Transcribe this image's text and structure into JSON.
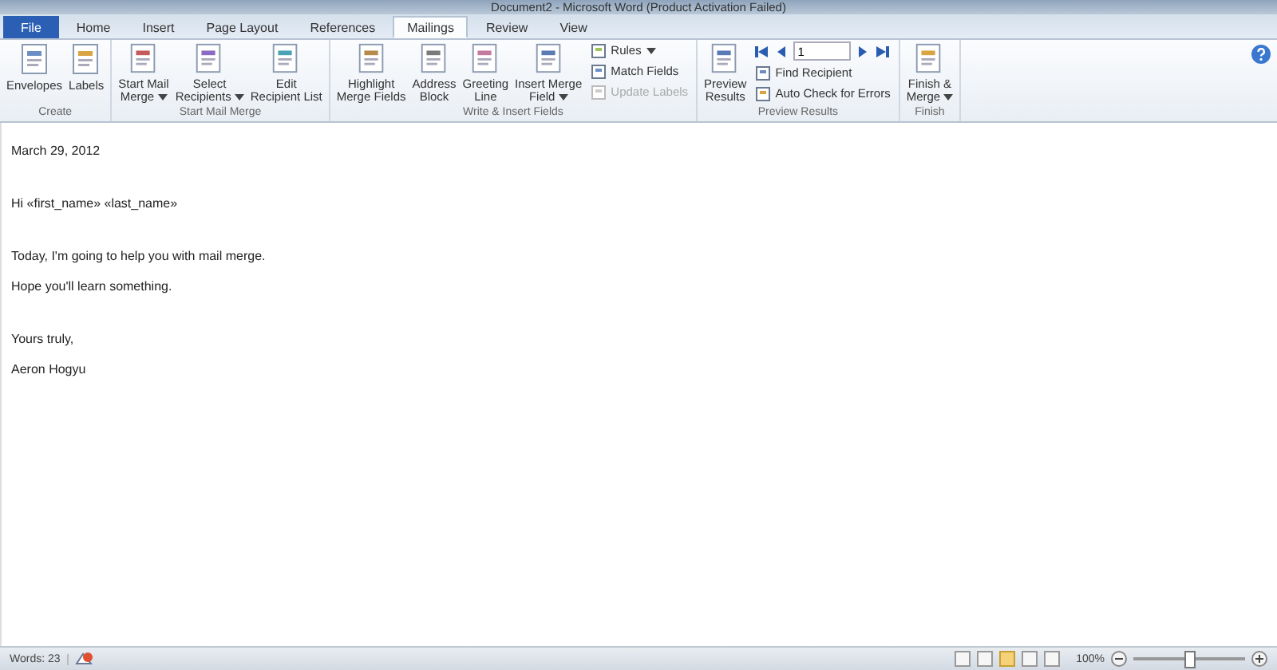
{
  "window": {
    "title": "Document2 - Microsoft Word (Product Activation Failed)"
  },
  "tabs": [
    {
      "label": "File",
      "selected": false,
      "kind": "file"
    },
    {
      "label": "Home",
      "selected": false,
      "kind": "tab"
    },
    {
      "label": "Insert",
      "selected": false,
      "kind": "tab"
    },
    {
      "label": "Page Layout",
      "selected": false,
      "kind": "tab"
    },
    {
      "label": "References",
      "selected": false,
      "kind": "tab"
    },
    {
      "label": "Mailings",
      "selected": true,
      "kind": "tab"
    },
    {
      "label": "Review",
      "selected": false,
      "kind": "tab"
    },
    {
      "label": "View",
      "selected": false,
      "kind": "tab"
    }
  ],
  "ribbon": {
    "groups": [
      {
        "label": "Create",
        "items": [
          {
            "kind": "large",
            "lines": [
              "Envelopes"
            ],
            "dropdown": false
          },
          {
            "kind": "large",
            "lines": [
              "Labels"
            ],
            "dropdown": false
          }
        ]
      },
      {
        "label": "Start Mail Merge",
        "items": [
          {
            "kind": "large",
            "lines": [
              "Start Mail",
              "Merge"
            ],
            "dropdown": true
          },
          {
            "kind": "large",
            "lines": [
              "Select",
              "Recipients"
            ],
            "dropdown": true
          },
          {
            "kind": "large",
            "lines": [
              "Edit",
              "Recipient List"
            ],
            "dropdown": false
          }
        ]
      },
      {
        "label": "Write & Insert Fields",
        "items": [
          {
            "kind": "large",
            "lines": [
              "Highlight",
              "Merge Fields"
            ],
            "dropdown": false
          },
          {
            "kind": "large",
            "lines": [
              "Address",
              "Block"
            ],
            "dropdown": false
          },
          {
            "kind": "large",
            "lines": [
              "Greeting",
              "Line"
            ],
            "dropdown": false
          },
          {
            "kind": "large",
            "lines": [
              "Insert Merge",
              "Field"
            ],
            "dropdown": true
          },
          {
            "kind": "small",
            "lines": [
              "Rules"
            ],
            "dropdown": true,
            "disabled": false
          },
          {
            "kind": "small",
            "lines": [
              "Match Fields"
            ],
            "dropdown": false,
            "disabled": false
          },
          {
            "kind": "small",
            "lines": [
              "Update Labels"
            ],
            "dropdown": false,
            "disabled": true
          }
        ]
      },
      {
        "label": "Preview Results",
        "items": [
          {
            "kind": "large",
            "lines": [
              "Preview",
              "Results"
            ],
            "dropdown": false
          },
          {
            "kind": "nav",
            "value": "1"
          },
          {
            "kind": "small",
            "lines": [
              "Find Recipient"
            ],
            "dropdown": false,
            "disabled": false
          },
          {
            "kind": "small",
            "lines": [
              "Auto Check for Errors"
            ],
            "dropdown": false,
            "disabled": false
          }
        ]
      },
      {
        "label": "Finish",
        "items": [
          {
            "kind": "large",
            "lines": [
              "Finish &",
              "Merge"
            ],
            "dropdown": true
          }
        ]
      }
    ]
  },
  "document": {
    "blocks": [
      [
        "March 29, 2012"
      ],
      [
        "Hi «first_name» «last_name»"
      ],
      [
        "Today, I'm going to help you with mail merge.",
        "Hope you'll learn something."
      ],
      [
        "Yours truly,",
        "Aeron Hogyu"
      ]
    ]
  },
  "status_bar": {
    "words": "Words: 23",
    "zoom": "100%",
    "zoom_slider": {
      "level": 0.5
    },
    "views": [
      {
        "selected": false
      },
      {
        "selected": false
      },
      {
        "selected": true
      },
      {
        "selected": false
      },
      {
        "selected": false
      }
    ]
  }
}
